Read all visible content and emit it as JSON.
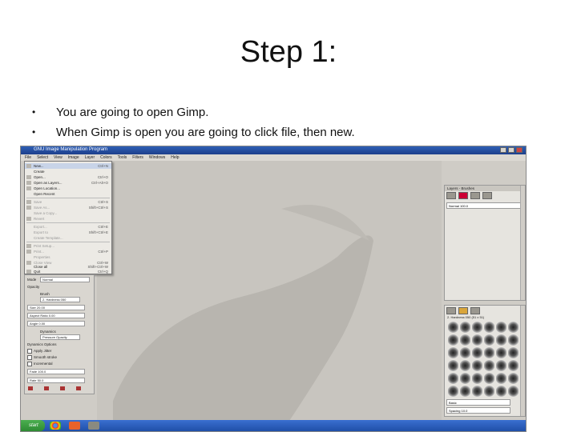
{
  "slide": {
    "title": "Step 1:",
    "bullets": [
      "You are going to open Gimp.",
      "When Gimp is open you are going to click file, then new."
    ]
  },
  "screenshot": {
    "window_title": "GNU Image Manipulation Program",
    "menus": [
      "File",
      "Select",
      "View",
      "Image",
      "Layer",
      "Colors",
      "Tools",
      "Filters",
      "Windows",
      "Help"
    ],
    "file_menu": [
      {
        "label": "New...",
        "shortcut": "Ctrl+N"
      },
      {
        "label": "Create",
        "shortcut": ""
      },
      {
        "label": "Open...",
        "shortcut": "Ctrl+O"
      },
      {
        "label": "Open as Layers...",
        "shortcut": "Ctrl+Alt+O"
      },
      {
        "label": "Open Location...",
        "shortcut": ""
      },
      {
        "label": "Open Recent",
        "shortcut": ""
      },
      {
        "label": "Save",
        "shortcut": "Ctrl+S"
      },
      {
        "label": "Save As...",
        "shortcut": "Shift+Ctrl+S"
      },
      {
        "label": "Save a Copy...",
        "shortcut": ""
      },
      {
        "label": "Revert",
        "shortcut": ""
      },
      {
        "label": "Export...",
        "shortcut": "Ctrl+E"
      },
      {
        "label": "Export to",
        "shortcut": "Shift+Ctrl+E"
      },
      {
        "label": "Create Template...",
        "shortcut": ""
      },
      {
        "label": "Print Setup...",
        "shortcut": ""
      },
      {
        "label": "Print...",
        "shortcut": "Ctrl+P"
      },
      {
        "label": "Properties",
        "shortcut": ""
      },
      {
        "label": "Close View",
        "shortcut": "Ctrl+W"
      },
      {
        "label": "Close all",
        "shortcut": "Shift+Ctrl+W"
      },
      {
        "label": "Quit",
        "shortcut": "Ctrl+Q"
      }
    ],
    "toolbox": {
      "mode_label": "Mode",
      "mode_value": "Normal",
      "opacity_label": "Opacity",
      "brush_label": "Brush",
      "brush_value": "2. Hardness 050",
      "size_label": "Size",
      "size_value": "20.00",
      "aspect_label": "Aspect Ratio",
      "aspect_value": "0.00",
      "angle_label": "Angle",
      "angle_value": "0.00",
      "dynamics_label": "Dynamics",
      "dynamics_value": "Pressure Opacity",
      "dynamics_options": "Dynamics Options",
      "apply_jitter": "Apply Jitter",
      "smooth_stroke": "Smooth stroke",
      "incremental": "Incremental",
      "fade_label": "Fade",
      "fade_value": "100.0",
      "rate_label": "Rate",
      "rate_value": "50.0"
    },
    "dock_top": {
      "tab": "Layers - Brushes",
      "mode": "Normal",
      "opacity_value": "100.0"
    },
    "dock_bottom": {
      "brush_name": "2. Hardness 050 (51 x 51)",
      "tag_placeholder": "Basic",
      "spacing_label": "Spacing",
      "spacing_value": "10.0"
    },
    "taskbar": {
      "start_label": "start"
    }
  }
}
